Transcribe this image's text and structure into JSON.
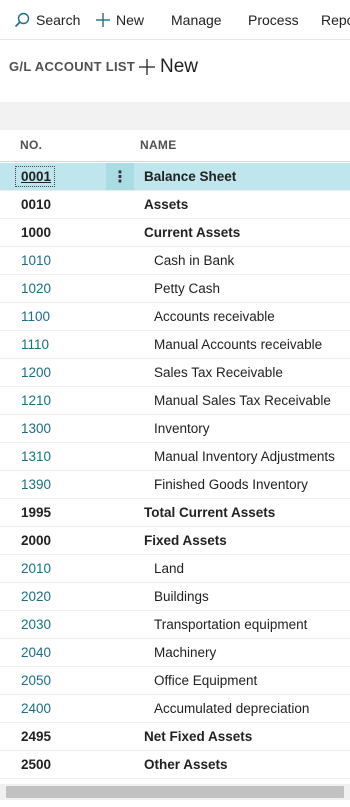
{
  "toolbar": {
    "search_label": "Search",
    "new_label": "New",
    "manage_label": "Manage",
    "process_label": "Process",
    "reports_label": "Repo"
  },
  "page": {
    "title": "G/L ACCOUNT LIST",
    "new_label": "New"
  },
  "table": {
    "columns": {
      "no": "NO.",
      "name": "NAME"
    },
    "rows": [
      {
        "no": "0001",
        "name": "Balance Sheet",
        "bold": true,
        "selected": true
      },
      {
        "no": "0010",
        "name": "Assets",
        "bold": true
      },
      {
        "no": "1000",
        "name": "Current Assets",
        "bold": true
      },
      {
        "no": "1010",
        "name": "Cash in Bank",
        "bold": false
      },
      {
        "no": "1020",
        "name": "Petty Cash",
        "bold": false
      },
      {
        "no": "1100",
        "name": "Accounts receivable",
        "bold": false
      },
      {
        "no": "1110",
        "name": "Manual Accounts receivable",
        "bold": false
      },
      {
        "no": "1200",
        "name": "Sales Tax Receivable",
        "bold": false
      },
      {
        "no": "1210",
        "name": "Manual Sales Tax Receivable",
        "bold": false
      },
      {
        "no": "1300",
        "name": "Inventory",
        "bold": false
      },
      {
        "no": "1310",
        "name": "Manual Inventory Adjustments",
        "bold": false
      },
      {
        "no": "1390",
        "name": "Finished Goods Inventory",
        "bold": false
      },
      {
        "no": "1995",
        "name": "Total Current Assets",
        "bold": true
      },
      {
        "no": "2000",
        "name": "Fixed Assets",
        "bold": true
      },
      {
        "no": "2010",
        "name": "Land",
        "bold": false
      },
      {
        "no": "2020",
        "name": "Buildings",
        "bold": false
      },
      {
        "no": "2030",
        "name": "Transportation equipment",
        "bold": false
      },
      {
        "no": "2040",
        "name": "Machinery",
        "bold": false
      },
      {
        "no": "2050",
        "name": "Office Equipment",
        "bold": false
      },
      {
        "no": "2400",
        "name": "Accumulated depreciation",
        "bold": false
      },
      {
        "no": "2495",
        "name": "Net Fixed Assets",
        "bold": true
      },
      {
        "no": "2500",
        "name": "Other Assets",
        "bold": true
      }
    ],
    "row_menu_glyph": "⋮"
  },
  "colors": {
    "selected_row": "#bfe6ec",
    "link_text": "#1a6e87"
  }
}
